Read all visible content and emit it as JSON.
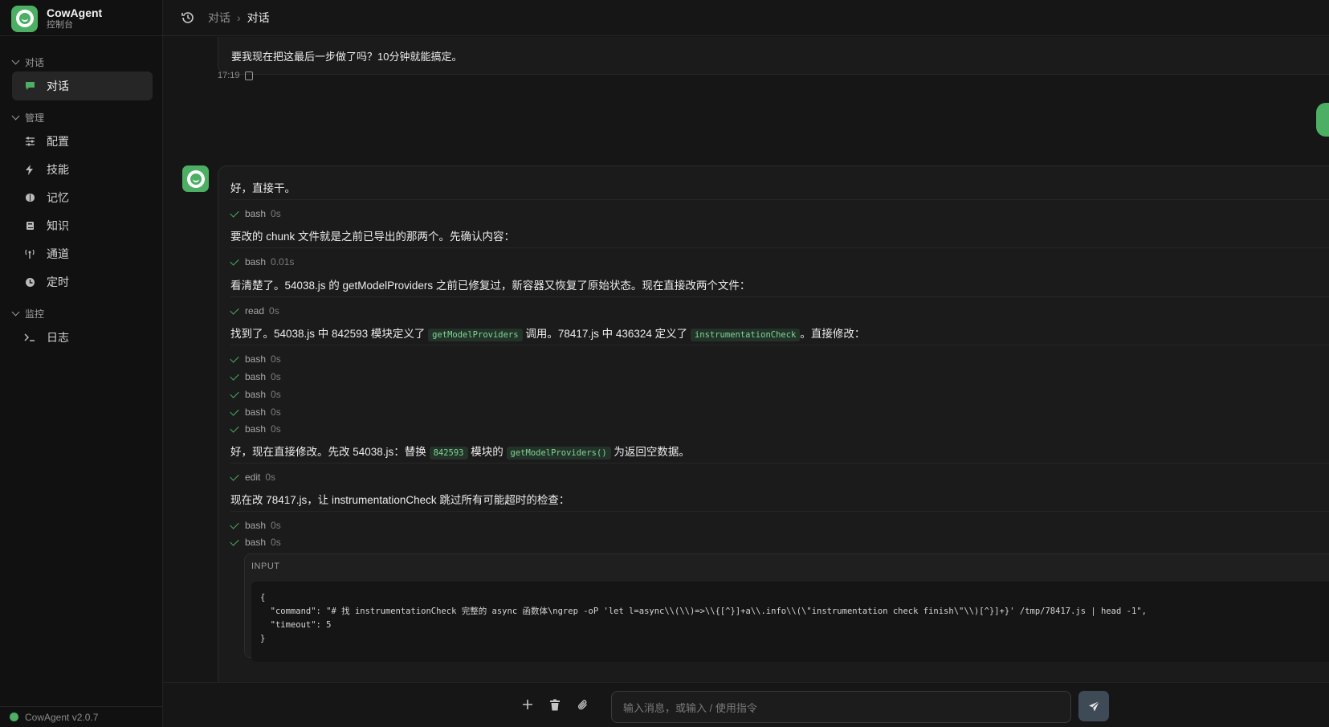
{
  "brand": {
    "name": "CowAgent",
    "subtitle": "控制台"
  },
  "sidebar": {
    "sections": [
      {
        "label": "对话"
      },
      {
        "label": "管理"
      },
      {
        "label": "监控"
      }
    ],
    "items": [
      {
        "label": "对话",
        "icon": "chat-icon",
        "active": true
      },
      {
        "label": "配置",
        "icon": "sliders-icon"
      },
      {
        "label": "技能",
        "icon": "bolt-icon"
      },
      {
        "label": "记忆",
        "icon": "brain-icon"
      },
      {
        "label": "知识",
        "icon": "book-icon"
      },
      {
        "label": "通道",
        "icon": "antenna-icon"
      },
      {
        "label": "定时",
        "icon": "clock-icon"
      },
      {
        "label": "日志",
        "icon": "terminal-icon"
      }
    ],
    "version": "CowAgent v2.0.7"
  },
  "header": {
    "crumb_parent": "对话",
    "crumb_current": "对话"
  },
  "chat": {
    "prev_message": "要我现在把这最后一步做了吗？10分钟就能搞定。",
    "prev_time": "17:19",
    "bot": {
      "intro": "好，直接干。",
      "t1": {
        "name": "bash",
        "dur": "0s"
      },
      "l1": "要改的 chunk 文件就是之前已导出的那两个。先确认内容：",
      "t2": {
        "name": "bash",
        "dur": "0.01s"
      },
      "l2": "看清楚了。54038.js 的 getModelProviders 之前已修复过，新容器又恢复了原始状态。现在直接改两个文件：",
      "t3": {
        "name": "read",
        "dur": "0s"
      },
      "l3": {
        "a": "找到了。54038.js 中 842593 模块定义了",
        "code1": "getModelProviders",
        "b": "调用。78417.js 中 436324 定义了",
        "code2": "instrumentationCheck",
        "c": "。直接修改："
      },
      "t4": [
        {
          "name": "bash",
          "dur": "0s"
        },
        {
          "name": "bash",
          "dur": "0s"
        },
        {
          "name": "bash",
          "dur": "0s"
        },
        {
          "name": "bash",
          "dur": "0s"
        },
        {
          "name": "bash",
          "dur": "0s"
        }
      ],
      "l4": {
        "a": "好，现在直接修改。先改 54038.js：替换",
        "code1": "842593",
        "b": "模块的",
        "code2": "getModelProviders()",
        "c": "为返回空数据。"
      },
      "t5": {
        "name": "edit",
        "dur": "0s"
      },
      "l5": "现在改 78417.js，让 instrumentationCheck 跳过所有可能超时的检查：",
      "t6": [
        {
          "name": "bash",
          "dur": "0s"
        },
        {
          "name": "bash",
          "dur": "0s"
        }
      ],
      "input_label": "INPUT",
      "input_code": "{\n  \"command\": \"# 找 instrumentationCheck 完整的 async 函数体\\ngrep -oP 'let l=async\\\\(\\\\)=>\\\\{[^}]+a\\\\.info\\\\(\\\"instrumentation check finish\\\"\\\\)[^}]+}' /tmp/78417.js | head -1\",\n  \"timeout\": 5\n}"
    }
  },
  "composer": {
    "placeholder": "输入消息，或输入 / 使用指令"
  }
}
